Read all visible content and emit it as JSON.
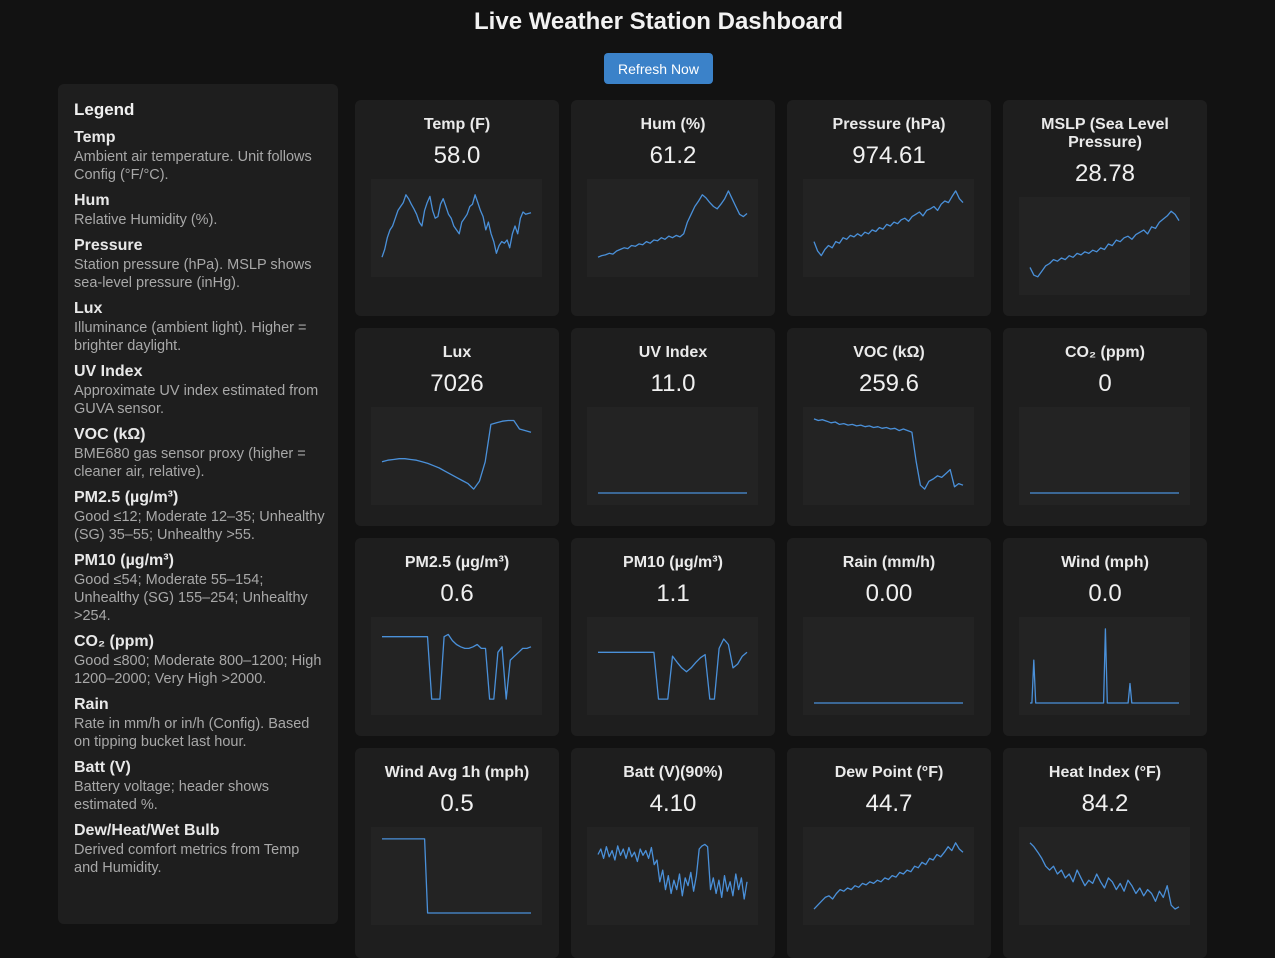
{
  "title": "Live Weather Station Dashboard",
  "refresh_label": "Refresh Now",
  "legend": {
    "heading": "Legend",
    "items": [
      {
        "name": "Temp",
        "desc": "Ambient air temperature. Unit follows Config (°F/°C)."
      },
      {
        "name": "Hum",
        "desc": "Relative Humidity (%)."
      },
      {
        "name": "Pressure",
        "desc": "Station pressure (hPa). MSLP shows sea-level pressure (inHg)."
      },
      {
        "name": "Lux",
        "desc": "Illuminance (ambient light). Higher = brighter daylight."
      },
      {
        "name": "UV Index",
        "desc": "Approximate UV index estimated from GUVA sensor."
      },
      {
        "name": "VOC (kΩ)",
        "desc": "BME680 gas sensor proxy (higher = cleaner air, relative)."
      },
      {
        "name": "PM2.5 (µg/m³)",
        "desc": "Good ≤12; Moderate 12–35; Unhealthy (SG) 35–55; Unhealthy >55."
      },
      {
        "name": "PM10 (µg/m³)",
        "desc": "Good ≤54; Moderate 55–154; Unhealthy (SG) 155–254; Unhealthy >254."
      },
      {
        "name": "CO₂ (ppm)",
        "desc": "Good ≤800; Moderate 800–1200; High 1200–2000; Very High >2000."
      },
      {
        "name": "Rain",
        "desc": "Rate in mm/h or in/h (Config). Based on tipping bucket last hour."
      },
      {
        "name": "Batt (V)",
        "desc": "Battery voltage; header shows estimated %."
      },
      {
        "name": "Dew/Heat/Wet Bulb",
        "desc": "Derived comfort metrics from Temp and Humidity."
      }
    ]
  },
  "colors": {
    "line": "#4a90d9",
    "accent": "#3b82c9",
    "card": "#1e1e1e",
    "background": "#121212"
  },
  "cards": [
    {
      "key": "temp",
      "label": "Temp (F)",
      "value": "58.0",
      "trend": [
        0.1,
        0.2,
        0.35,
        0.45,
        0.5,
        0.6,
        0.7,
        0.75,
        0.8,
        0.9,
        0.85,
        0.78,
        0.72,
        0.65,
        0.55,
        0.5,
        0.7,
        0.8,
        0.88,
        0.7,
        0.6,
        0.62,
        0.78,
        0.85,
        0.75,
        0.65,
        0.6,
        0.5,
        0.45,
        0.4,
        0.55,
        0.6,
        0.65,
        0.75,
        0.78,
        0.9,
        0.8,
        0.7,
        0.62,
        0.45,
        0.55,
        0.4,
        0.3,
        0.15,
        0.25,
        0.3,
        0.28,
        0.32,
        0.22,
        0.4,
        0.5,
        0.4,
        0.6,
        0.68,
        0.65,
        0.66,
        0.67
      ]
    },
    {
      "key": "hum",
      "label": "Hum (%)",
      "value": "61.2",
      "trend": [
        0.1,
        0.12,
        0.13,
        0.15,
        0.14,
        0.18,
        0.2,
        0.22,
        0.21,
        0.25,
        0.24,
        0.27,
        0.26,
        0.3,
        0.28,
        0.32,
        0.31,
        0.35,
        0.33,
        0.37,
        0.35,
        0.38,
        0.36,
        0.4,
        0.55,
        0.65,
        0.75,
        0.82,
        0.9,
        0.86,
        0.8,
        0.75,
        0.72,
        0.78,
        0.85,
        0.95,
        0.85,
        0.75,
        0.65,
        0.62,
        0.66
      ]
    },
    {
      "key": "pressure",
      "label": "Pressure (hPa)",
      "value": "974.61",
      "trend": [
        0.3,
        0.18,
        0.12,
        0.2,
        0.25,
        0.22,
        0.3,
        0.28,
        0.35,
        0.33,
        0.38,
        0.36,
        0.4,
        0.37,
        0.42,
        0.4,
        0.45,
        0.43,
        0.48,
        0.46,
        0.52,
        0.5,
        0.55,
        0.53,
        0.58,
        0.6,
        0.56,
        0.62,
        0.65,
        0.68,
        0.63,
        0.7,
        0.72,
        0.75,
        0.7,
        0.78,
        0.82,
        0.8,
        0.88,
        0.95,
        0.85,
        0.8
      ]
    },
    {
      "key": "mslp",
      "label": "MSLP (Sea Level Pressure)",
      "value": "28.78",
      "trend": [
        0.2,
        0.1,
        0.08,
        0.15,
        0.22,
        0.25,
        0.3,
        0.28,
        0.32,
        0.3,
        0.35,
        0.33,
        0.38,
        0.36,
        0.4,
        0.38,
        0.42,
        0.4,
        0.45,
        0.43,
        0.5,
        0.48,
        0.55,
        0.53,
        0.58,
        0.6,
        0.56,
        0.62,
        0.65,
        0.68,
        0.63,
        0.72,
        0.7,
        0.78,
        0.82,
        0.86,
        0.92,
        0.88,
        0.8
      ]
    },
    {
      "key": "lux",
      "label": "Lux",
      "value": "7026",
      "trend": [
        0.4,
        0.42,
        0.43,
        0.44,
        0.44,
        0.43,
        0.42,
        0.4,
        0.38,
        0.35,
        0.32,
        0.28,
        0.24,
        0.2,
        0.16,
        0.12,
        0.05,
        0.15,
        0.4,
        0.88,
        0.9,
        0.92,
        0.93,
        0.93,
        0.82,
        0.8,
        0.78
      ]
    },
    {
      "key": "uv",
      "label": "UV Index",
      "value": "11.0",
      "trend": [
        0.0,
        0.0,
        0.0,
        0.0,
        0.0,
        0.0,
        0.0,
        0.0,
        0.0,
        0.0
      ]
    },
    {
      "key": "voc",
      "label": "VOC (kΩ)",
      "value": "259.6",
      "trend": [
        0.95,
        0.93,
        0.94,
        0.92,
        0.9,
        0.91,
        0.88,
        0.89,
        0.87,
        0.88,
        0.86,
        0.87,
        0.85,
        0.86,
        0.84,
        0.85,
        0.83,
        0.84,
        0.82,
        0.83,
        0.8,
        0.82,
        0.8,
        0.78,
        0.4,
        0.1,
        0.05,
        0.15,
        0.18,
        0.22,
        0.2,
        0.25,
        0.3,
        0.08,
        0.12,
        0.1
      ]
    },
    {
      "key": "co2",
      "label": "CO₂ (ppm)",
      "value": "0",
      "trend": [
        0.0,
        0.0,
        0.0,
        0.0,
        0.0,
        0.0,
        0.0,
        0.0,
        0.0,
        0.0
      ]
    },
    {
      "key": "pm25",
      "label": "PM2.5 (µg/m³)",
      "value": "0.6",
      "trend": [
        0.85,
        0.85,
        0.85,
        0.85,
        0.85,
        0.85,
        0.85,
        0.85,
        0.85,
        0.85,
        0.85,
        0.85,
        0.05,
        0.05,
        0.05,
        0.85,
        0.88,
        0.8,
        0.75,
        0.72,
        0.7,
        0.7,
        0.72,
        0.75,
        0.7,
        0.7,
        0.05,
        0.05,
        0.65,
        0.72,
        0.05,
        0.55,
        0.6,
        0.65,
        0.7,
        0.7,
        0.72
      ]
    },
    {
      "key": "pm10",
      "label": "PM10 (µg/m³)",
      "value": "1.1",
      "trend": [
        0.65,
        0.65,
        0.65,
        0.65,
        0.65,
        0.65,
        0.65,
        0.65,
        0.65,
        0.65,
        0.65,
        0.65,
        0.65,
        0.05,
        0.05,
        0.05,
        0.6,
        0.52,
        0.45,
        0.4,
        0.45,
        0.52,
        0.58,
        0.62,
        0.05,
        0.05,
        0.7,
        0.82,
        0.75,
        0.45,
        0.5,
        0.6,
        0.65
      ]
    },
    {
      "key": "rain",
      "label": "Rain (mm/h)",
      "value": "0.00",
      "trend": [
        0.0,
        0.0,
        0.0,
        0.0,
        0.0,
        0.0,
        0.0,
        0.0,
        0.0,
        0.0
      ]
    },
    {
      "key": "wind",
      "label": "Wind (mph)",
      "value": "0.0",
      "trend": [
        0,
        0,
        0.55,
        0,
        0,
        0,
        0,
        0,
        0,
        0,
        0,
        0,
        0,
        0,
        0,
        0,
        0,
        0,
        0,
        0,
        0,
        0,
        0,
        0,
        0,
        0,
        0,
        0,
        0,
        0,
        0,
        0,
        0,
        0,
        0,
        0,
        0,
        0,
        0,
        0,
        0.95,
        0,
        0,
        0,
        0,
        0,
        0,
        0,
        0,
        0,
        0,
        0,
        0,
        0.25,
        0,
        0,
        0,
        0,
        0,
        0,
        0,
        0,
        0,
        0,
        0,
        0,
        0,
        0,
        0,
        0,
        0,
        0,
        0,
        0,
        0,
        0,
        0,
        0,
        0,
        0
      ]
    },
    {
      "key": "windavg",
      "label": "Wind Avg 1h (mph)",
      "value": "0.5",
      "trend": [
        0.95,
        0.95,
        0.95,
        0.95,
        0.95,
        0.95,
        0.95,
        0.95,
        0.95,
        0.95,
        0.95,
        0.95,
        0.95,
        0.95,
        0.95,
        0.0,
        0.0,
        0.0,
        0.0,
        0.0,
        0.0,
        0.0,
        0.0,
        0.0,
        0.0,
        0.0,
        0.0,
        0.0,
        0.0,
        0.0,
        0.0,
        0.0,
        0.0,
        0.0,
        0.0,
        0.0,
        0.0,
        0.0,
        0.0,
        0.0,
        0.0,
        0.0,
        0.0,
        0.0,
        0.0,
        0.0,
        0.0,
        0.0,
        0.0,
        0.0
      ]
    },
    {
      "key": "batt",
      "label": "Batt (V)(90%)",
      "value": "4.10",
      "trend": [
        0.75,
        0.82,
        0.7,
        0.85,
        0.72,
        0.8,
        0.68,
        0.86,
        0.74,
        0.82,
        0.7,
        0.84,
        0.72,
        0.78,
        0.66,
        0.82,
        0.74,
        0.8,
        0.7,
        0.84,
        0.62,
        0.68,
        0.4,
        0.55,
        0.3,
        0.48,
        0.25,
        0.42,
        0.3,
        0.5,
        0.22,
        0.45,
        0.35,
        0.52,
        0.28,
        0.48,
        0.82,
        0.86,
        0.88,
        0.85,
        0.3,
        0.45,
        0.25,
        0.42,
        0.2,
        0.48,
        0.28,
        0.4,
        0.22,
        0.5,
        0.3,
        0.45,
        0.18,
        0.4
      ]
    },
    {
      "key": "dewpoint",
      "label": "Dew Point (°F)",
      "value": "44.7",
      "trend": [
        0.05,
        0.1,
        0.15,
        0.2,
        0.22,
        0.18,
        0.25,
        0.3,
        0.28,
        0.32,
        0.3,
        0.35,
        0.33,
        0.38,
        0.36,
        0.4,
        0.38,
        0.42,
        0.4,
        0.45,
        0.43,
        0.48,
        0.46,
        0.52,
        0.5,
        0.55,
        0.53,
        0.6,
        0.58,
        0.65,
        0.62,
        0.7,
        0.68,
        0.75,
        0.72,
        0.78,
        0.85,
        0.8,
        0.9,
        0.82,
        0.78
      ]
    },
    {
      "key": "heatindex",
      "label": "Heat Index (°F)",
      "value": "84.2",
      "trend": [
        0.9,
        0.85,
        0.78,
        0.7,
        0.6,
        0.55,
        0.6,
        0.5,
        0.55,
        0.45,
        0.5,
        0.4,
        0.55,
        0.45,
        0.35,
        0.42,
        0.38,
        0.5,
        0.4,
        0.32,
        0.45,
        0.4,
        0.3,
        0.38,
        0.28,
        0.42,
        0.35,
        0.25,
        0.32,
        0.22,
        0.3,
        0.25,
        0.15,
        0.28,
        0.2,
        0.35,
        0.1,
        0.05,
        0.08
      ]
    }
  ]
}
